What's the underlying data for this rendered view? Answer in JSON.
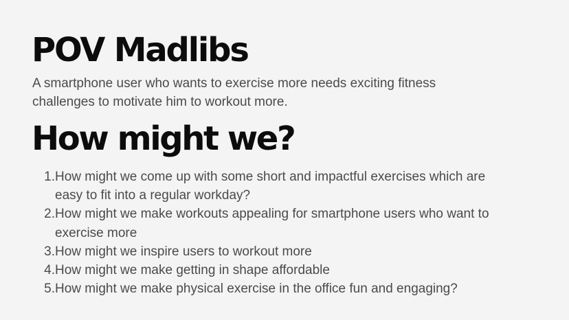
{
  "slide": {
    "title": "POV Madlibs",
    "pov_statement": "A smartphone user who wants to exercise more needs exciting fitness challenges to motivate him to workout more.",
    "subtitle": "How might we?",
    "questions": [
      {
        "number": "1.",
        "text": "How might we come up with some short and impactful exercises which are easy to fit into a regular workday?"
      },
      {
        "number": "2.",
        "text": "How might we make workouts appealing for smartphone users who want to exercise more"
      },
      {
        "number": "3.",
        "text": "How might we inspire users to workout more"
      },
      {
        "number": "4.",
        "text": "How might we make getting in shape affordable"
      },
      {
        "number": "5.",
        "text": "How might we make physical exercise in the office fun and engaging?"
      }
    ]
  }
}
